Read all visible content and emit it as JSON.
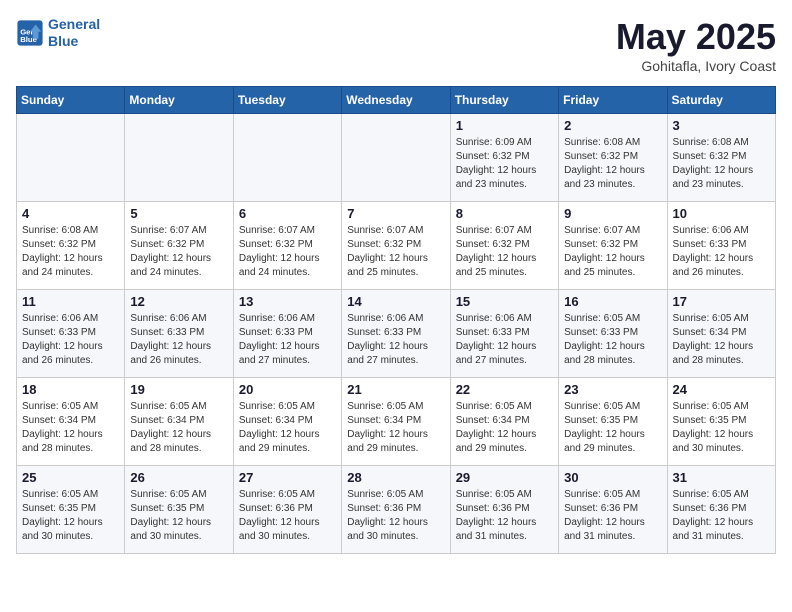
{
  "header": {
    "logo_line1": "General",
    "logo_line2": "Blue",
    "month_year": "May 2025",
    "location": "Gohitafla, Ivory Coast"
  },
  "weekdays": [
    "Sunday",
    "Monday",
    "Tuesday",
    "Wednesday",
    "Thursday",
    "Friday",
    "Saturday"
  ],
  "weeks": [
    [
      {
        "day": "",
        "sunrise": "",
        "sunset": "",
        "daylight": ""
      },
      {
        "day": "",
        "sunrise": "",
        "sunset": "",
        "daylight": ""
      },
      {
        "day": "",
        "sunrise": "",
        "sunset": "",
        "daylight": ""
      },
      {
        "day": "",
        "sunrise": "",
        "sunset": "",
        "daylight": ""
      },
      {
        "day": "1",
        "sunrise": "Sunrise: 6:09 AM",
        "sunset": "Sunset: 6:32 PM",
        "daylight": "Daylight: 12 hours and 23 minutes."
      },
      {
        "day": "2",
        "sunrise": "Sunrise: 6:08 AM",
        "sunset": "Sunset: 6:32 PM",
        "daylight": "Daylight: 12 hours and 23 minutes."
      },
      {
        "day": "3",
        "sunrise": "Sunrise: 6:08 AM",
        "sunset": "Sunset: 6:32 PM",
        "daylight": "Daylight: 12 hours and 23 minutes."
      }
    ],
    [
      {
        "day": "4",
        "sunrise": "Sunrise: 6:08 AM",
        "sunset": "Sunset: 6:32 PM",
        "daylight": "Daylight: 12 hours and 24 minutes."
      },
      {
        "day": "5",
        "sunrise": "Sunrise: 6:07 AM",
        "sunset": "Sunset: 6:32 PM",
        "daylight": "Daylight: 12 hours and 24 minutes."
      },
      {
        "day": "6",
        "sunrise": "Sunrise: 6:07 AM",
        "sunset": "Sunset: 6:32 PM",
        "daylight": "Daylight: 12 hours and 24 minutes."
      },
      {
        "day": "7",
        "sunrise": "Sunrise: 6:07 AM",
        "sunset": "Sunset: 6:32 PM",
        "daylight": "Daylight: 12 hours and 25 minutes."
      },
      {
        "day": "8",
        "sunrise": "Sunrise: 6:07 AM",
        "sunset": "Sunset: 6:32 PM",
        "daylight": "Daylight: 12 hours and 25 minutes."
      },
      {
        "day": "9",
        "sunrise": "Sunrise: 6:07 AM",
        "sunset": "Sunset: 6:32 PM",
        "daylight": "Daylight: 12 hours and 25 minutes."
      },
      {
        "day": "10",
        "sunrise": "Sunrise: 6:06 AM",
        "sunset": "Sunset: 6:33 PM",
        "daylight": "Daylight: 12 hours and 26 minutes."
      }
    ],
    [
      {
        "day": "11",
        "sunrise": "Sunrise: 6:06 AM",
        "sunset": "Sunset: 6:33 PM",
        "daylight": "Daylight: 12 hours and 26 minutes."
      },
      {
        "day": "12",
        "sunrise": "Sunrise: 6:06 AM",
        "sunset": "Sunset: 6:33 PM",
        "daylight": "Daylight: 12 hours and 26 minutes."
      },
      {
        "day": "13",
        "sunrise": "Sunrise: 6:06 AM",
        "sunset": "Sunset: 6:33 PM",
        "daylight": "Daylight: 12 hours and 27 minutes."
      },
      {
        "day": "14",
        "sunrise": "Sunrise: 6:06 AM",
        "sunset": "Sunset: 6:33 PM",
        "daylight": "Daylight: 12 hours and 27 minutes."
      },
      {
        "day": "15",
        "sunrise": "Sunrise: 6:06 AM",
        "sunset": "Sunset: 6:33 PM",
        "daylight": "Daylight: 12 hours and 27 minutes."
      },
      {
        "day": "16",
        "sunrise": "Sunrise: 6:05 AM",
        "sunset": "Sunset: 6:33 PM",
        "daylight": "Daylight: 12 hours and 28 minutes."
      },
      {
        "day": "17",
        "sunrise": "Sunrise: 6:05 AM",
        "sunset": "Sunset: 6:34 PM",
        "daylight": "Daylight: 12 hours and 28 minutes."
      }
    ],
    [
      {
        "day": "18",
        "sunrise": "Sunrise: 6:05 AM",
        "sunset": "Sunset: 6:34 PM",
        "daylight": "Daylight: 12 hours and 28 minutes."
      },
      {
        "day": "19",
        "sunrise": "Sunrise: 6:05 AM",
        "sunset": "Sunset: 6:34 PM",
        "daylight": "Daylight: 12 hours and 28 minutes."
      },
      {
        "day": "20",
        "sunrise": "Sunrise: 6:05 AM",
        "sunset": "Sunset: 6:34 PM",
        "daylight": "Daylight: 12 hours and 29 minutes."
      },
      {
        "day": "21",
        "sunrise": "Sunrise: 6:05 AM",
        "sunset": "Sunset: 6:34 PM",
        "daylight": "Daylight: 12 hours and 29 minutes."
      },
      {
        "day": "22",
        "sunrise": "Sunrise: 6:05 AM",
        "sunset": "Sunset: 6:34 PM",
        "daylight": "Daylight: 12 hours and 29 minutes."
      },
      {
        "day": "23",
        "sunrise": "Sunrise: 6:05 AM",
        "sunset": "Sunset: 6:35 PM",
        "daylight": "Daylight: 12 hours and 29 minutes."
      },
      {
        "day": "24",
        "sunrise": "Sunrise: 6:05 AM",
        "sunset": "Sunset: 6:35 PM",
        "daylight": "Daylight: 12 hours and 30 minutes."
      }
    ],
    [
      {
        "day": "25",
        "sunrise": "Sunrise: 6:05 AM",
        "sunset": "Sunset: 6:35 PM",
        "daylight": "Daylight: 12 hours and 30 minutes."
      },
      {
        "day": "26",
        "sunrise": "Sunrise: 6:05 AM",
        "sunset": "Sunset: 6:35 PM",
        "daylight": "Daylight: 12 hours and 30 minutes."
      },
      {
        "day": "27",
        "sunrise": "Sunrise: 6:05 AM",
        "sunset": "Sunset: 6:36 PM",
        "daylight": "Daylight: 12 hours and 30 minutes."
      },
      {
        "day": "28",
        "sunrise": "Sunrise: 6:05 AM",
        "sunset": "Sunset: 6:36 PM",
        "daylight": "Daylight: 12 hours and 30 minutes."
      },
      {
        "day": "29",
        "sunrise": "Sunrise: 6:05 AM",
        "sunset": "Sunset: 6:36 PM",
        "daylight": "Daylight: 12 hours and 31 minutes."
      },
      {
        "day": "30",
        "sunrise": "Sunrise: 6:05 AM",
        "sunset": "Sunset: 6:36 PM",
        "daylight": "Daylight: 12 hours and 31 minutes."
      },
      {
        "day": "31",
        "sunrise": "Sunrise: 6:05 AM",
        "sunset": "Sunset: 6:36 PM",
        "daylight": "Daylight: 12 hours and 31 minutes."
      }
    ]
  ]
}
